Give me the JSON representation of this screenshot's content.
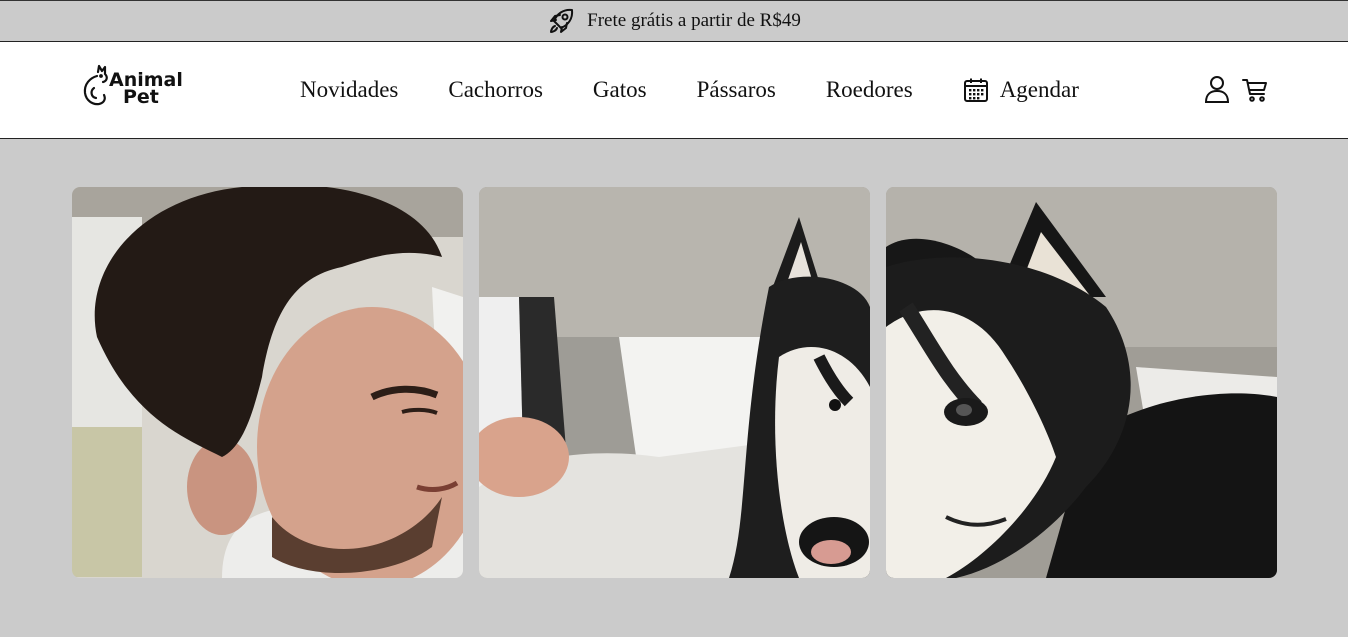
{
  "announcement": {
    "icon": "rocket-icon",
    "text": "Frete grátis a partir de R$49"
  },
  "brand": {
    "line1": "Animal",
    "line2": "Pet",
    "icon": "cat-logo-icon"
  },
  "nav": {
    "items": [
      {
        "label": "Novidades"
      },
      {
        "label": "Cachorros"
      },
      {
        "label": "Gatos"
      },
      {
        "label": "Pássaros"
      },
      {
        "label": "Roedores"
      }
    ],
    "schedule": {
      "label": "Agendar",
      "icon": "calendar-icon"
    }
  },
  "actions": {
    "account_icon": "user-icon",
    "cart_icon": "cart-icon"
  },
  "gallery": {
    "photos": [
      {
        "subject": "man-in-car-photo"
      },
      {
        "subject": "man-and-husky-photo"
      },
      {
        "subject": "husky-closeup-photo"
      }
    ]
  },
  "colors": {
    "page_bg": "#cbcbcb",
    "header_bg": "#ffffff",
    "text": "#111111"
  }
}
